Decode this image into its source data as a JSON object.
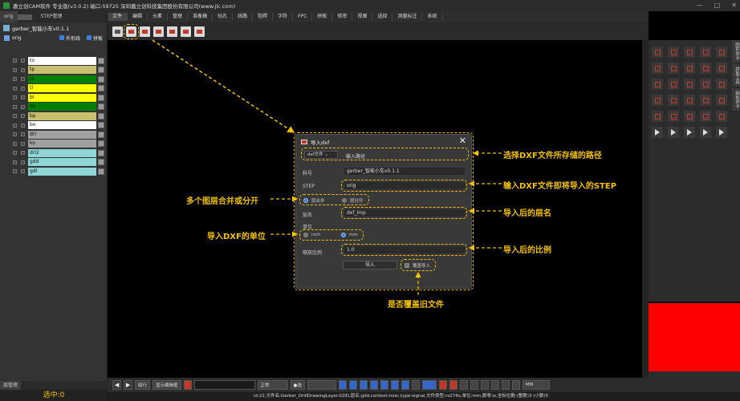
{
  "window": {
    "title": "嘉立创CAM软件 专业版(v3.0.2) 端口:59725     深圳嘉立创科技集团股份有限公司(www.jlc.com)",
    "controls": [
      "—",
      "□",
      "✕"
    ]
  },
  "left_panel": {
    "tabs": [
      "orig",
      "STEP管理"
    ],
    "product": "gerber_智能小车v0.1.1",
    "step": {
      "name": "orig",
      "opt1": "外形线",
      "opt2": "拼板"
    },
    "layers": [
      {
        "name": "to",
        "color": "#ffffff"
      },
      {
        "name": "tp",
        "color": "#c8c06e"
      },
      {
        "name": "ts",
        "color": "#008000"
      },
      {
        "name": "tl",
        "color": "#ffff00"
      },
      {
        "name": "bl",
        "color": "#ffff00"
      },
      {
        "name": "bs",
        "color": "#008000"
      },
      {
        "name": "bp",
        "color": "#c8c06e"
      },
      {
        "name": "bo",
        "color": "#ffffff"
      },
      {
        "name": "drl",
        "color": "#a0a0a0"
      },
      {
        "name": "ko",
        "color": "#a0a0a0"
      },
      {
        "name": "drl2",
        "color": "#8fd6d6"
      },
      {
        "name": "gdd",
        "color": "#8fd6d6"
      },
      {
        "name": "gdl",
        "color": "#8fd6d6"
      }
    ],
    "bottom_tab": "层管理",
    "selection": "选中:0"
  },
  "menu": [
    "文件",
    "编辑",
    "元素",
    "管理",
    "准备稿",
    "钻孔",
    "线路",
    "阻焊",
    "字符",
    "FPC",
    "拼板",
    "修审",
    "视图",
    "选择",
    "测量标注",
    "系统"
  ],
  "dialog": {
    "title": "导入dxf",
    "close": "✕",
    "select": "dxf文件 ⌄",
    "path_label": "输入路径",
    "material_label": "料号",
    "material_value": "gerber_智能小车v0.1.1",
    "step_label": "STEP",
    "step_value": "orig",
    "merge_label": "层合并",
    "split_label": "层分开",
    "layer_label": "层名",
    "layer_value": "dxf_imp",
    "unit_label": "单位",
    "unit_inch": "inch",
    "unit_mm": "mm",
    "scale_label": "缩放比例",
    "scale_value": "1.0",
    "import_btn": "导入",
    "overwrite_label": "覆盖导入"
  },
  "annotations": {
    "path": "选择DXF文件所存储的路径",
    "step": "输入DXF文件即将导入的STEP",
    "merge": "多个图层合并或分开",
    "layer": "导入后的层名",
    "unit": "导入DXF的单位",
    "scale": "导入后的比例",
    "overwrite": "是否覆盖旧文件"
  },
  "right_panel": {
    "tabs": [
      "图形命令",
      "拼板工具",
      "画板命令"
    ]
  },
  "bottom_toolbar": {
    "mode": "绘行",
    "display": "显示编辑框",
    "line_style": "正常",
    "select": "●选",
    "unit": "MM"
  },
  "status": "id:22,文件名:Gerber_DrillDrawingLayer.GDD,层名:gdd,context:misc,type:signal,文件类型:rs274x,单位:mm,数零:lz,坐标位数:(整数)3 (小数)5",
  "colors": {
    "accent": "#f2c100",
    "canvas": "#000000",
    "red_block": "#ff0000"
  }
}
